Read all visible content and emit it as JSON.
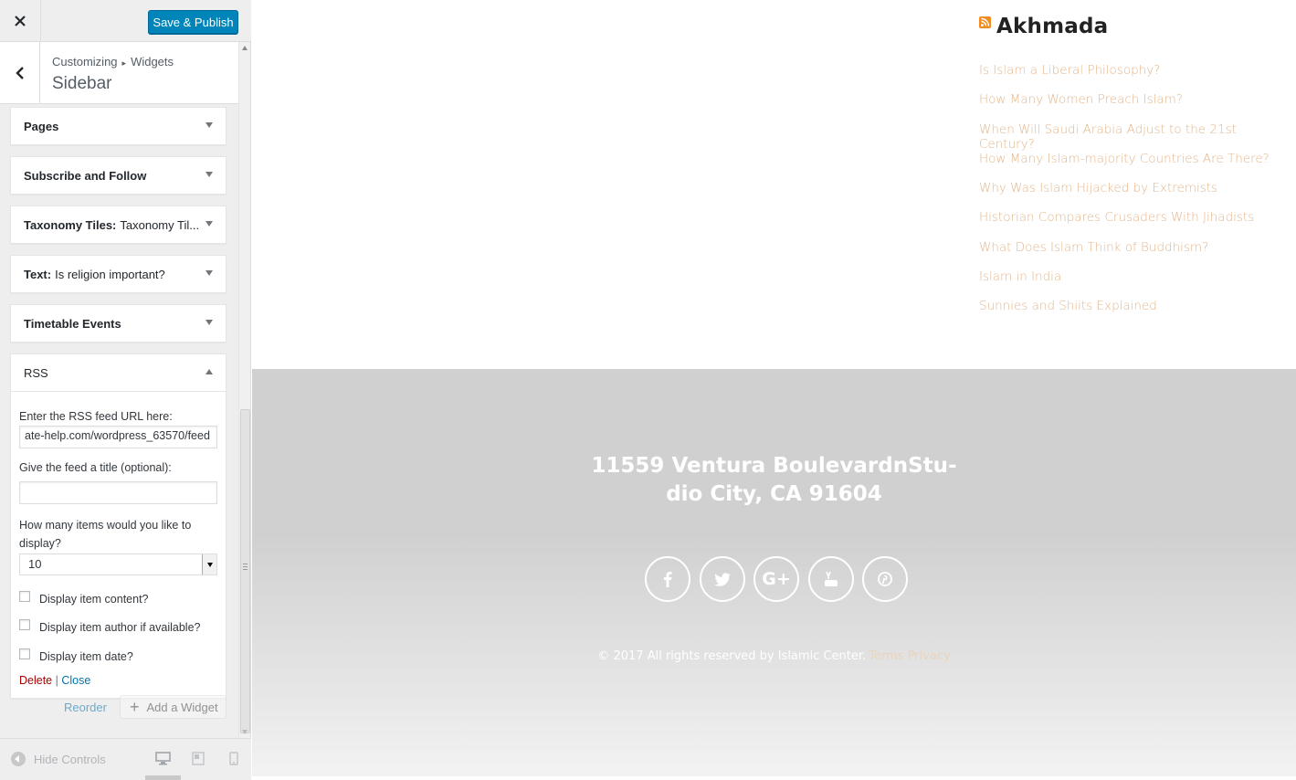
{
  "header": {
    "save_label": "Save & Publish"
  },
  "section": {
    "breadcrumb_parent": "Customizing",
    "breadcrumb_separator": "▸",
    "breadcrumb_child": "Widgets",
    "title": "Sidebar"
  },
  "widgets": [
    {
      "name": "Pages",
      "subtitle": ""
    },
    {
      "name": "Subscribe and Follow",
      "subtitle": ""
    },
    {
      "name": "Taxonomy Tiles:",
      "subtitle": "Taxonomy Til..."
    },
    {
      "name": "Text:",
      "subtitle": "Is religion important?"
    },
    {
      "name": "Timetable Events",
      "subtitle": ""
    }
  ],
  "rss_widget": {
    "name": "RSS",
    "url_label": "Enter the RSS feed URL here:",
    "url_value": "ate-help.com/wordpress_63570/feed",
    "title_label": "Give the feed a title (optional):",
    "title_value": "",
    "items_label": "How many items would you like to display?",
    "items_value": "10",
    "show_content_label": "Display item content?",
    "show_author_label": "Display item author if available?",
    "show_date_label": "Display item date?",
    "show_content": false,
    "show_author": false,
    "show_date": false,
    "delete_label": "Delete",
    "link_separator": "|",
    "close_label": "Close"
  },
  "actions": {
    "reorder_label": "Reorder",
    "add_label": "Add a Widget"
  },
  "footer_controls": {
    "hide_label": "Hide Controls"
  },
  "preview": {
    "rss_title": "Akhmada",
    "items": [
      "Is Islam a Liberal Philosophy?",
      "How Many Women Preach Islam?",
      "When Will Saudi Arabia Adjust to the 21st Century?",
      "How Many Islam-majority Countries Are There?",
      "Why Was Islam Hijacked by Extremists",
      "Historian Compares Crusaders With Jihadists",
      "What Does Islam Think of Buddhism?",
      "Islam in India",
      "Sunnies and Shiits Explained"
    ],
    "address_line1": "11559 Ventura BoulevardnStu-",
    "address_line2": "dio City, CA 91604",
    "social_icons": [
      "facebook-icon",
      "twitter-icon",
      "google-plus-icon",
      "youtube-icon",
      "pinterest-icon"
    ],
    "copyright": "© 2017 All rights reserved by Islamic Center.",
    "footer_links": "Terms Privacy"
  },
  "colors": {
    "primary_button": "#0085ba",
    "delete_link": "#aa0000",
    "close_link": "#0073aa",
    "preview_link": "#e3b68d",
    "footer_bg": "#d0d0d0"
  }
}
